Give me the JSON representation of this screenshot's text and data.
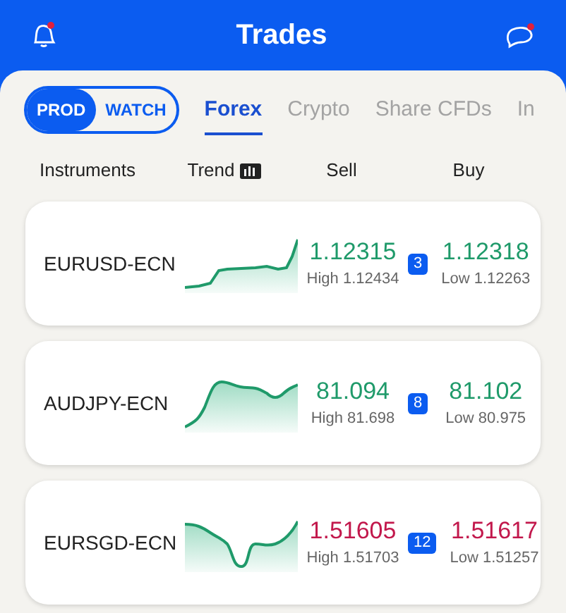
{
  "header": {
    "title": "Trades"
  },
  "mode_toggle": [
    {
      "label": "PROD",
      "selected": true
    },
    {
      "label": "WATCH",
      "selected": false
    }
  ],
  "tabs": [
    {
      "label": "Forex",
      "selected": true
    },
    {
      "label": "Crypto",
      "selected": false
    },
    {
      "label": "Share CFDs",
      "selected": false
    },
    {
      "label": "In",
      "selected": false
    }
  ],
  "columns": [
    "Instruments",
    "Trend",
    "Sell",
    "Buy"
  ],
  "rows": [
    {
      "instrument": "EURUSD-ECN",
      "color": "#1f9a6a",
      "sell": "1.12315",
      "high": "High 1.12434",
      "spread": "3",
      "buy": "1.12318",
      "low": "Low 1.12263"
    },
    {
      "instrument": "AUDJPY-ECN",
      "color": "#1f9a6a",
      "sell": "81.094",
      "high": "High 81.698",
      "spread": "8",
      "buy": "81.102",
      "low": "Low 80.975"
    },
    {
      "instrument": "EURSGD-ECN",
      "color": "#c2184c",
      "sell": "1.51605",
      "high": "High 1.51703",
      "spread": "12",
      "buy": "1.51617",
      "low": "Low 1.51257"
    }
  ]
}
